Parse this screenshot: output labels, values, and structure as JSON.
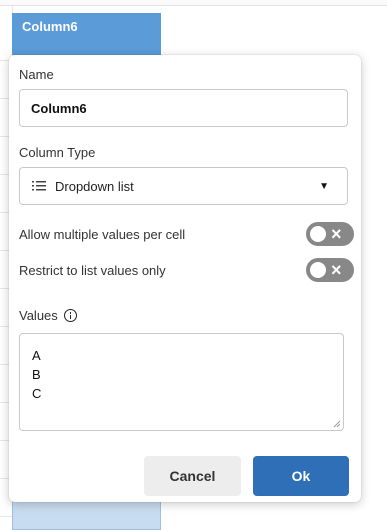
{
  "grid": {
    "column_header": "Column6"
  },
  "dialog": {
    "name_label": "Name",
    "name_value": "Column6",
    "type_label": "Column Type",
    "type_value": "Dropdown list",
    "toggles": [
      {
        "label": "Allow multiple values per cell",
        "on": false
      },
      {
        "label": "Restrict to list values only",
        "on": false
      }
    ],
    "values_label": "Values",
    "values": [
      "A",
      "B",
      "C"
    ],
    "cancel_label": "Cancel",
    "ok_label": "Ok"
  },
  "colors": {
    "header": "#5b9bd8",
    "ok_button": "#2e6fb7",
    "toggle_off": "#888888"
  }
}
